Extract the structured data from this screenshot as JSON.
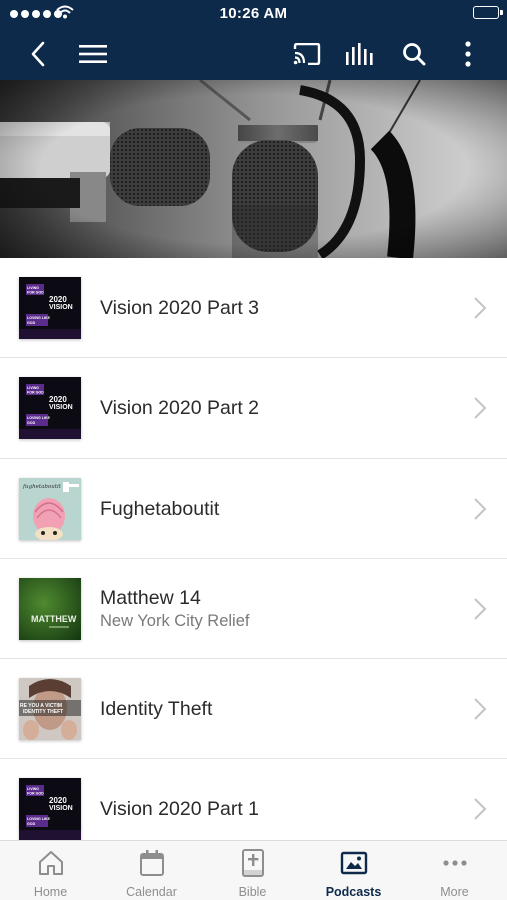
{
  "status_bar": {
    "time": "10:26 AM"
  },
  "nav": {
    "back_icon": "chevron-left-icon",
    "menu_icon": "hamburger-menu-icon",
    "cast_icon": "cast-icon",
    "audio_icon": "audio-bars-icon",
    "search_icon": "search-icon",
    "more_icon": "vertical-dots-icon"
  },
  "hero": {
    "image": "studio microphone photo"
  },
  "episodes": [
    {
      "title": "Vision 2020 Part 3",
      "subtitle": "",
      "art": {
        "line1": "LIVING",
        "line2": "FOR GOD",
        "line3": "LOVING LIKE",
        "line4": "GOD",
        "year": "2020",
        "word": "VISION"
      }
    },
    {
      "title": "Vision 2020 Part 2",
      "subtitle": "",
      "art": {
        "line1": "LIVING",
        "line2": "FOR GOD",
        "line3": "LOVING LIKE",
        "line4": "GOD",
        "year": "2020",
        "word": "VISION"
      }
    },
    {
      "title": "Fughetaboutit",
      "subtitle": "",
      "art": {
        "caption": "fughetaboutit"
      }
    },
    {
      "title": "Matthew 14",
      "subtitle": "New York City Relief",
      "art": {
        "caption": "MATTHEW"
      }
    },
    {
      "title": "Identity Theft",
      "subtitle": "",
      "art": {
        "line1": "RE YOU A VICTIM",
        "line2": "IDENTITY THEFT"
      }
    },
    {
      "title": "Vision 2020 Part 1",
      "subtitle": "",
      "art": {
        "line1": "LIVING",
        "line2": "FOR GOD",
        "line3": "LOVING LIKE",
        "line4": "GOD",
        "year": "2020",
        "word": "VISION"
      }
    }
  ],
  "tabs": [
    {
      "label": "Home",
      "icon": "home-icon",
      "active": false
    },
    {
      "label": "Calendar",
      "icon": "calendar-icon",
      "active": false
    },
    {
      "label": "Bible",
      "icon": "bible-icon",
      "active": false
    },
    {
      "label": "Podcasts",
      "icon": "podcasts-image-icon",
      "active": true
    },
    {
      "label": "More",
      "icon": "more-dots-icon",
      "active": false
    }
  ],
  "colors": {
    "nav_bg": "#0d2a4a",
    "active_tab": "#0d2a4a",
    "inactive_tab": "#8e8e8e"
  }
}
